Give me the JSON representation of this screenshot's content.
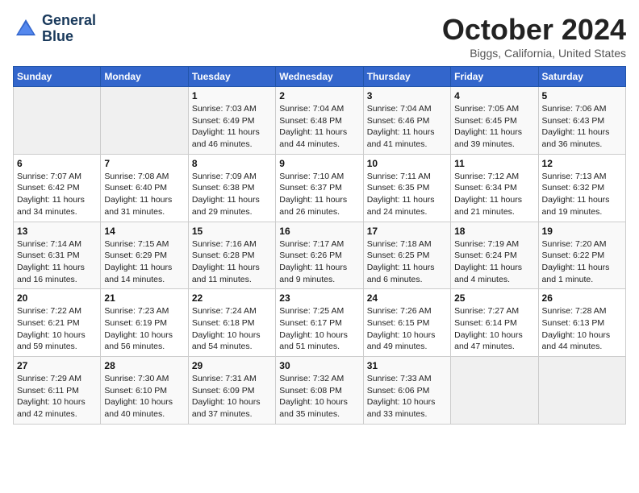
{
  "logo": {
    "line1": "General",
    "line2": "Blue"
  },
  "title": "October 2024",
  "subtitle": "Biggs, California, United States",
  "days_of_week": [
    "Sunday",
    "Monday",
    "Tuesday",
    "Wednesday",
    "Thursday",
    "Friday",
    "Saturday"
  ],
  "weeks": [
    [
      {
        "day": "",
        "empty": true
      },
      {
        "day": "",
        "empty": true
      },
      {
        "day": "1",
        "sunrise": "Sunrise: 7:03 AM",
        "sunset": "Sunset: 6:49 PM",
        "daylight": "Daylight: 11 hours and 46 minutes."
      },
      {
        "day": "2",
        "sunrise": "Sunrise: 7:04 AM",
        "sunset": "Sunset: 6:48 PM",
        "daylight": "Daylight: 11 hours and 44 minutes."
      },
      {
        "day": "3",
        "sunrise": "Sunrise: 7:04 AM",
        "sunset": "Sunset: 6:46 PM",
        "daylight": "Daylight: 11 hours and 41 minutes."
      },
      {
        "day": "4",
        "sunrise": "Sunrise: 7:05 AM",
        "sunset": "Sunset: 6:45 PM",
        "daylight": "Daylight: 11 hours and 39 minutes."
      },
      {
        "day": "5",
        "sunrise": "Sunrise: 7:06 AM",
        "sunset": "Sunset: 6:43 PM",
        "daylight": "Daylight: 11 hours and 36 minutes."
      }
    ],
    [
      {
        "day": "6",
        "sunrise": "Sunrise: 7:07 AM",
        "sunset": "Sunset: 6:42 PM",
        "daylight": "Daylight: 11 hours and 34 minutes."
      },
      {
        "day": "7",
        "sunrise": "Sunrise: 7:08 AM",
        "sunset": "Sunset: 6:40 PM",
        "daylight": "Daylight: 11 hours and 31 minutes."
      },
      {
        "day": "8",
        "sunrise": "Sunrise: 7:09 AM",
        "sunset": "Sunset: 6:38 PM",
        "daylight": "Daylight: 11 hours and 29 minutes."
      },
      {
        "day": "9",
        "sunrise": "Sunrise: 7:10 AM",
        "sunset": "Sunset: 6:37 PM",
        "daylight": "Daylight: 11 hours and 26 minutes."
      },
      {
        "day": "10",
        "sunrise": "Sunrise: 7:11 AM",
        "sunset": "Sunset: 6:35 PM",
        "daylight": "Daylight: 11 hours and 24 minutes."
      },
      {
        "day": "11",
        "sunrise": "Sunrise: 7:12 AM",
        "sunset": "Sunset: 6:34 PM",
        "daylight": "Daylight: 11 hours and 21 minutes."
      },
      {
        "day": "12",
        "sunrise": "Sunrise: 7:13 AM",
        "sunset": "Sunset: 6:32 PM",
        "daylight": "Daylight: 11 hours and 19 minutes."
      }
    ],
    [
      {
        "day": "13",
        "sunrise": "Sunrise: 7:14 AM",
        "sunset": "Sunset: 6:31 PM",
        "daylight": "Daylight: 11 hours and 16 minutes."
      },
      {
        "day": "14",
        "sunrise": "Sunrise: 7:15 AM",
        "sunset": "Sunset: 6:29 PM",
        "daylight": "Daylight: 11 hours and 14 minutes."
      },
      {
        "day": "15",
        "sunrise": "Sunrise: 7:16 AM",
        "sunset": "Sunset: 6:28 PM",
        "daylight": "Daylight: 11 hours and 11 minutes."
      },
      {
        "day": "16",
        "sunrise": "Sunrise: 7:17 AM",
        "sunset": "Sunset: 6:26 PM",
        "daylight": "Daylight: 11 hours and 9 minutes."
      },
      {
        "day": "17",
        "sunrise": "Sunrise: 7:18 AM",
        "sunset": "Sunset: 6:25 PM",
        "daylight": "Daylight: 11 hours and 6 minutes."
      },
      {
        "day": "18",
        "sunrise": "Sunrise: 7:19 AM",
        "sunset": "Sunset: 6:24 PM",
        "daylight": "Daylight: 11 hours and 4 minutes."
      },
      {
        "day": "19",
        "sunrise": "Sunrise: 7:20 AM",
        "sunset": "Sunset: 6:22 PM",
        "daylight": "Daylight: 11 hours and 1 minute."
      }
    ],
    [
      {
        "day": "20",
        "sunrise": "Sunrise: 7:22 AM",
        "sunset": "Sunset: 6:21 PM",
        "daylight": "Daylight: 10 hours and 59 minutes."
      },
      {
        "day": "21",
        "sunrise": "Sunrise: 7:23 AM",
        "sunset": "Sunset: 6:19 PM",
        "daylight": "Daylight: 10 hours and 56 minutes."
      },
      {
        "day": "22",
        "sunrise": "Sunrise: 7:24 AM",
        "sunset": "Sunset: 6:18 PM",
        "daylight": "Daylight: 10 hours and 54 minutes."
      },
      {
        "day": "23",
        "sunrise": "Sunrise: 7:25 AM",
        "sunset": "Sunset: 6:17 PM",
        "daylight": "Daylight: 10 hours and 51 minutes."
      },
      {
        "day": "24",
        "sunrise": "Sunrise: 7:26 AM",
        "sunset": "Sunset: 6:15 PM",
        "daylight": "Daylight: 10 hours and 49 minutes."
      },
      {
        "day": "25",
        "sunrise": "Sunrise: 7:27 AM",
        "sunset": "Sunset: 6:14 PM",
        "daylight": "Daylight: 10 hours and 47 minutes."
      },
      {
        "day": "26",
        "sunrise": "Sunrise: 7:28 AM",
        "sunset": "Sunset: 6:13 PM",
        "daylight": "Daylight: 10 hours and 44 minutes."
      }
    ],
    [
      {
        "day": "27",
        "sunrise": "Sunrise: 7:29 AM",
        "sunset": "Sunset: 6:11 PM",
        "daylight": "Daylight: 10 hours and 42 minutes."
      },
      {
        "day": "28",
        "sunrise": "Sunrise: 7:30 AM",
        "sunset": "Sunset: 6:10 PM",
        "daylight": "Daylight: 10 hours and 40 minutes."
      },
      {
        "day": "29",
        "sunrise": "Sunrise: 7:31 AM",
        "sunset": "Sunset: 6:09 PM",
        "daylight": "Daylight: 10 hours and 37 minutes."
      },
      {
        "day": "30",
        "sunrise": "Sunrise: 7:32 AM",
        "sunset": "Sunset: 6:08 PM",
        "daylight": "Daylight: 10 hours and 35 minutes."
      },
      {
        "day": "31",
        "sunrise": "Sunrise: 7:33 AM",
        "sunset": "Sunset: 6:06 PM",
        "daylight": "Daylight: 10 hours and 33 minutes."
      },
      {
        "day": "",
        "empty": true
      },
      {
        "day": "",
        "empty": true
      }
    ]
  ]
}
